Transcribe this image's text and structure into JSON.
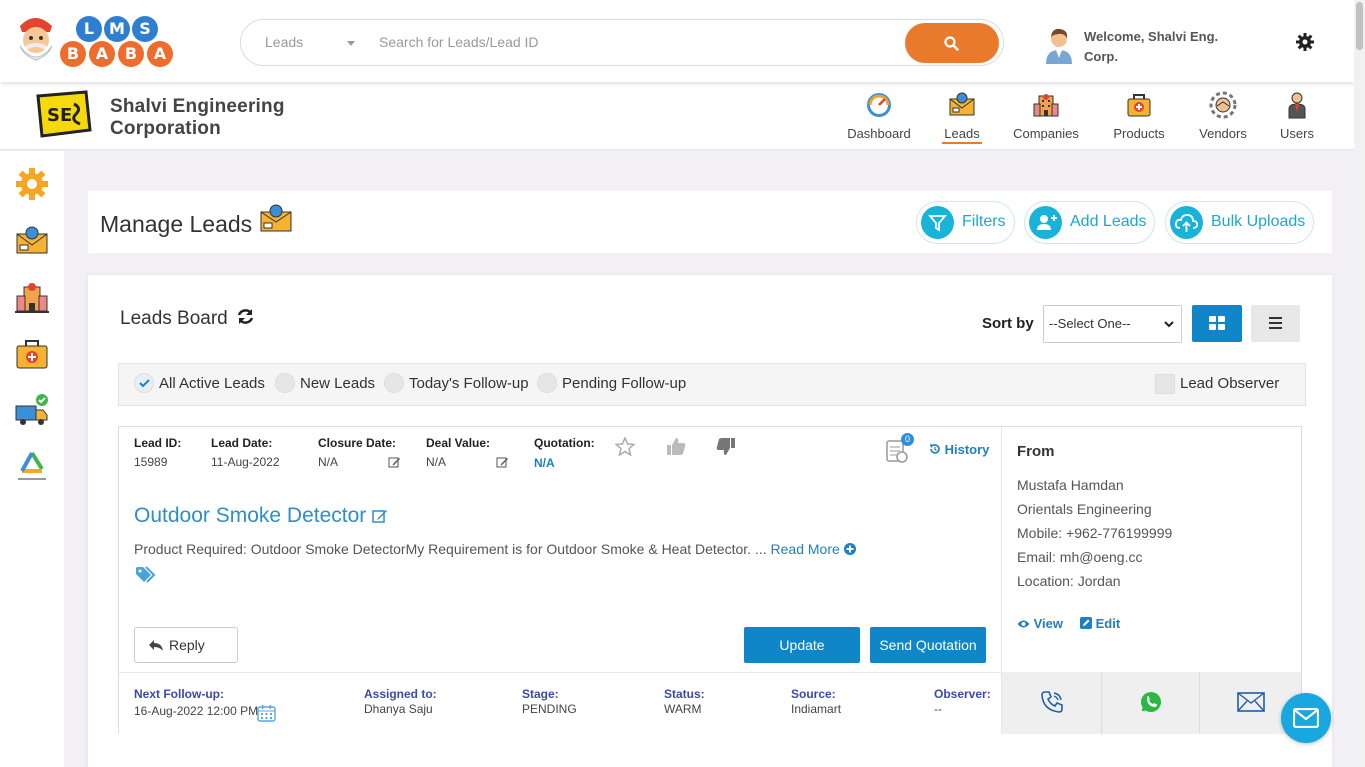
{
  "header": {
    "logo_letters": [
      "L",
      "M",
      "S",
      "B",
      "A",
      "B",
      "A"
    ],
    "search": {
      "category": "Leads",
      "placeholder": "Search for Leads/Lead ID"
    },
    "welcome": "Welcome, Shalvi Eng. Corp."
  },
  "company": {
    "logo_text": "SE",
    "name_line1": "Shalvi Engineering",
    "name_line2": "Corporation"
  },
  "nav": [
    {
      "label": "Dashboard",
      "icon": "dashboard-gauge-icon"
    },
    {
      "label": "Leads",
      "icon": "leads-envelope-icon",
      "active": true
    },
    {
      "label": "Companies",
      "icon": "companies-building-icon"
    },
    {
      "label": "Products",
      "icon": "products-bag-icon"
    },
    {
      "label": "Vendors",
      "icon": "vendors-handshake-icon"
    },
    {
      "label": "Users",
      "icon": "users-person-icon"
    }
  ],
  "sidebar": [
    "settings-gear-icon",
    "leads-envelope-icon",
    "companies-building-icon",
    "products-bag-icon",
    "delivery-truck-icon",
    "recycle-icon"
  ],
  "manage": {
    "title": "Manage Leads",
    "filters_label": "Filters",
    "add_label": "Add Leads",
    "bulk_label": "Bulk Uploads"
  },
  "board": {
    "title": "Leads Board",
    "sort_label": "Sort by",
    "sort_value": "--Select One--",
    "tabs": [
      "All Active Leads",
      "New Leads",
      "Today's Follow-up",
      "Pending Follow-up"
    ],
    "observer_label": "Lead Observer"
  },
  "lead": {
    "id_label": "Lead ID:",
    "id": "15989",
    "date_label": "Lead Date:",
    "date": "11-Aug-2022",
    "closure_label": "Closure Date:",
    "closure": "N/A",
    "deal_label": "Deal Value:",
    "deal": "N/A",
    "quotation_label": "Quotation:",
    "quotation": "N/A",
    "notes_count": "0",
    "history_label": "History",
    "title": "Outdoor Smoke Detector",
    "description": "Product Required: Outdoor Smoke DetectorMy Requirement is for Outdoor Smoke & Heat Detector. ...",
    "read_more": "Read More",
    "reply_label": "Reply",
    "update_label": "Update",
    "send_quotation_label": "Send Quotation",
    "footer": {
      "followup_label": "Next Follow-up:",
      "followup": "16-Aug-2022 12:00 PM",
      "assigned_label": "Assigned to:",
      "assigned": "Dhanya Saju",
      "stage_label": "Stage:",
      "stage": "PENDING",
      "status_label": "Status:",
      "status": "WARM",
      "source_label": "Source:",
      "source": "Indiamart",
      "observer_label": "Observer:",
      "observer": "--"
    },
    "contact": {
      "from_label": "From",
      "name": "Mustafa Hamdan",
      "company": "Orientals Engineering",
      "mobile": "Mobile: +962-776199999",
      "email": "Email: mh@oeng.cc",
      "location": "Location: Jordan",
      "view_label": "View",
      "edit_label": "Edit"
    }
  },
  "colors": {
    "accent_orange": "#e97a2c",
    "primary_blue": "#0e86c8",
    "cyan": "#19b3d9",
    "bubble_blue": "#2e7fd0",
    "bubble_orange": "#ef6c2f"
  }
}
